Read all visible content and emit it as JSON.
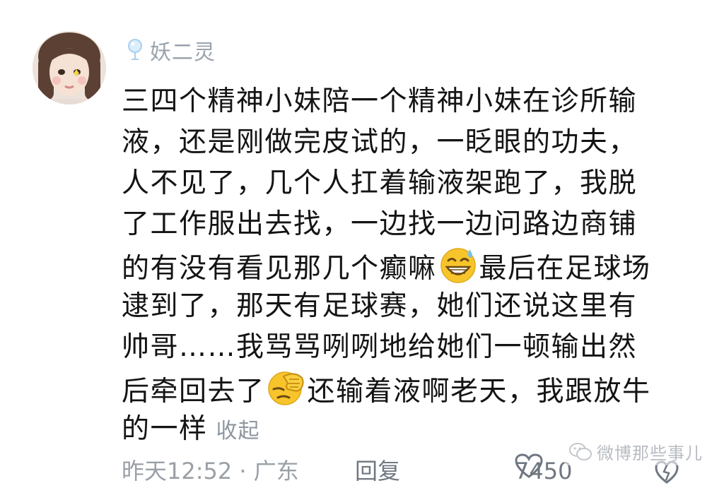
{
  "comment": {
    "username": "妖二灵",
    "lines": [
      "三四个精神小妹陪一个精神小妹在诊所输",
      "液，还是刚做完皮试的，一眨眼的功夫，",
      "人不见了，几个人扛着输液架跑了，我脱",
      "了工作服出去找，一边找一边问路边商铺",
      {
        "before": "的有没有看见那几个癫嘛",
        "emoji": "grinning-sweat-emoji",
        "after": "最后在足球场"
      },
      "逮到了，那天有足球赛，她们还说这里有",
      "帅哥……我骂骂咧咧地给她们一顿输出然",
      {
        "before": "后牵回去了",
        "emoji": "facepalm-emoji",
        "after": "还输着液啊老天，我跟放牛"
      },
      "的一样"
    ],
    "collapse_label": "收起",
    "time": "昨天12:52 · 广东",
    "reply_label": "回复",
    "likes": "7450"
  },
  "watermark": "微博那些事儿",
  "colors": {
    "text": "#141414",
    "muted": "#9aa0a6",
    "username": "#9aa3ad",
    "emoji_yellow": "#f7c52b"
  }
}
